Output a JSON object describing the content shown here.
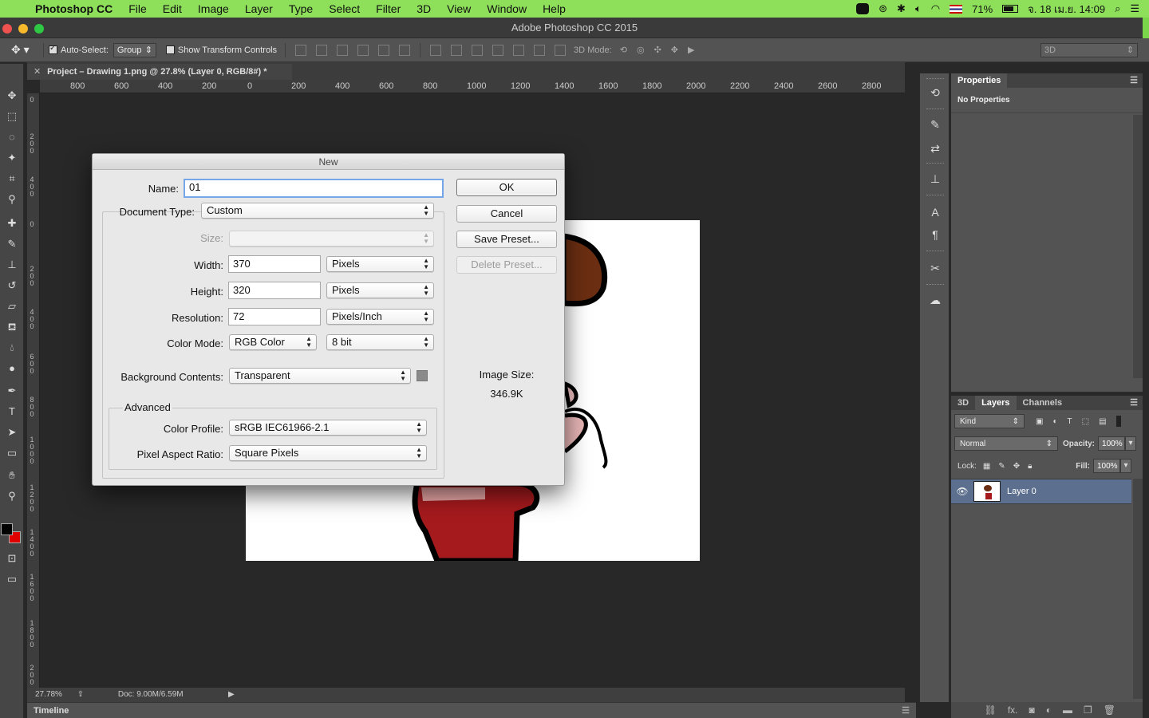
{
  "menubar": {
    "app_name": "Photoshop CC",
    "items": [
      "File",
      "Edit",
      "Image",
      "Layer",
      "Type",
      "Select",
      "Filter",
      "3D",
      "View",
      "Window",
      "Help"
    ],
    "battery": "71%",
    "datetime": "จ. 18 เม.ย. 14:09"
  },
  "window": {
    "title": "Adobe Photoshop CC 2015"
  },
  "options_bar": {
    "auto_select_label": "Auto-Select:",
    "auto_select_value": "Group",
    "transform_label": "Show Transform Controls",
    "mode_label": "3D Mode:",
    "workspace_value": "3D"
  },
  "document": {
    "tab_title": "Project – Drawing 1.png @ 27.8% (Layer 0, RGB/8#) *",
    "ruler_ticks": [
      "800",
      "600",
      "400",
      "200",
      "0",
      "200",
      "400",
      "600",
      "800",
      "1000",
      "1200",
      "1400",
      "1600",
      "1800",
      "2000",
      "2200",
      "2400",
      "2600",
      "2800"
    ],
    "vruler_ticks": [
      "0",
      "2 0 0",
      "4 0 0",
      "0",
      "2 0 0",
      "4 0 0",
      "6 0 0",
      "8 0 0",
      "1 0 0 0",
      "1 2 0 0",
      "1 4 0 0",
      "1 6 0 0",
      "1 8 0 0",
      "2 0 0"
    ]
  },
  "status": {
    "zoom": "27.78%",
    "doc_size": "Doc: 9.00M/6.59M"
  },
  "timeline": {
    "label": "Timeline"
  },
  "properties_panel": {
    "tab": "Properties",
    "empty_text": "No Properties"
  },
  "layers_panel": {
    "tabs": [
      "3D",
      "Layers",
      "Channels"
    ],
    "filter_kind": "Kind",
    "blend_mode": "Normal",
    "opacity_label": "Opacity:",
    "opacity_value": "100%",
    "lock_label": "Lock:",
    "fill_label": "Fill:",
    "fill_value": "100%",
    "layers": [
      {
        "name": "Layer 0",
        "visible": true,
        "selected": true
      }
    ]
  },
  "dialog": {
    "title": "New",
    "name_label": "Name:",
    "name_value": "01",
    "doctype_label": "Document Type:",
    "doctype_value": "Custom",
    "size_label": "Size:",
    "size_value": "",
    "width_label": "Width:",
    "width_value": "370",
    "width_unit": "Pixels",
    "height_label": "Height:",
    "height_value": "320",
    "height_unit": "Pixels",
    "resolution_label": "Resolution:",
    "resolution_value": "72",
    "resolution_unit": "Pixels/Inch",
    "colormode_label": "Color Mode:",
    "colormode_value": "RGB Color",
    "bitdepth_value": "8 bit",
    "bg_label": "Background Contents:",
    "bg_value": "Transparent",
    "advanced_label": "Advanced",
    "profile_label": "Color Profile:",
    "profile_value": "sRGB IEC61966-2.1",
    "aspect_label": "Pixel Aspect Ratio:",
    "aspect_value": "Square Pixels",
    "image_size_label": "Image Size:",
    "image_size_value": "346.9K",
    "buttons": {
      "ok": "OK",
      "cancel": "Cancel",
      "save_preset": "Save Preset...",
      "delete_preset": "Delete Preset..."
    }
  },
  "colors": {
    "menubar_bg": "#8ee05a",
    "accent_selected_layer": "#5c6f8e",
    "foreground_color": "#000000",
    "background_color": "#e00000"
  }
}
